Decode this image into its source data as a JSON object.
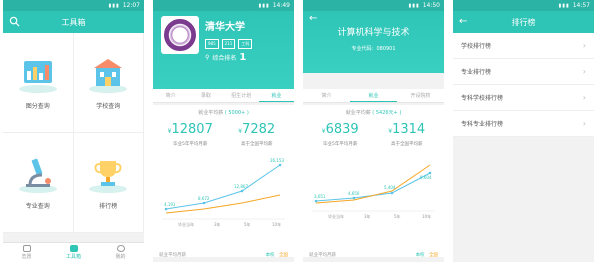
{
  "colors": {
    "accent": "#2ec4b6",
    "secondary": "#f5a623",
    "background": "#f2f2f2"
  },
  "screens": [
    {
      "status_time": "12:07",
      "title": "工具箱",
      "tools": [
        {
          "label": "图分查询",
          "icon": "chart-board-icon"
        },
        {
          "label": "学校查询",
          "icon": "school-building-icon"
        },
        {
          "label": "专业查询",
          "icon": "microscope-icon"
        },
        {
          "label": "排行榜",
          "icon": "trophy-icon"
        }
      ],
      "tabbar": [
        {
          "label": "志愿",
          "icon": "home-icon"
        },
        {
          "label": "工具箱",
          "icon": "toolbox-icon"
        },
        {
          "label": "我的",
          "icon": "user-icon"
        }
      ]
    },
    {
      "status_time": "14:49",
      "university_name": "清华大学",
      "tags": [
        "985",
        "211",
        "工科"
      ],
      "rank_label": "综合排名",
      "rank_value": "1",
      "subtabs": [
        "简介",
        "录取",
        "招生计划",
        "就业"
      ],
      "caption_prefix": "就业平均薪",
      "caption_value": "( 5000+ )",
      "stat_left": {
        "value": "12807",
        "desc": "毕业5年平均月薪"
      },
      "stat_right": {
        "value": "7282",
        "desc": "高于全国平均薪"
      },
      "chart_labels": [
        "4,191",
        "8,672",
        "12,807",
        "26,153"
      ],
      "x_labels": [
        "毕业当年",
        "3年",
        "5年",
        "10年"
      ],
      "legend_text": "就业平均月薪",
      "legend_keys": [
        "本校",
        "全国"
      ]
    },
    {
      "status_time": "14:50",
      "major_title": "计算机科学与技术",
      "major_code": "专业代码：080901",
      "subtabs": [
        "简介",
        "就业",
        "开设院校"
      ],
      "caption_prefix": "就业平均薪",
      "caption_value": "( 5426元+ )",
      "stat_left": {
        "value": "6839",
        "desc": "毕业5年平均月薪"
      },
      "stat_right": {
        "value": "1314",
        "desc": "高于全国平均薪"
      },
      "chart_labels": [
        "3,051",
        "4,650",
        "5,404",
        "9,604"
      ],
      "x_labels": [
        "毕业当年",
        "3年",
        "5年",
        "10年"
      ],
      "legend_text": "就业平均月薪",
      "legend_keys": [
        "本校",
        "全国"
      ]
    },
    {
      "status_time": "14:57",
      "title": "排行榜",
      "items": [
        "学校排行榜",
        "专业排行榜",
        "专科学校排行榜",
        "专科专业排行榜"
      ]
    }
  ]
}
